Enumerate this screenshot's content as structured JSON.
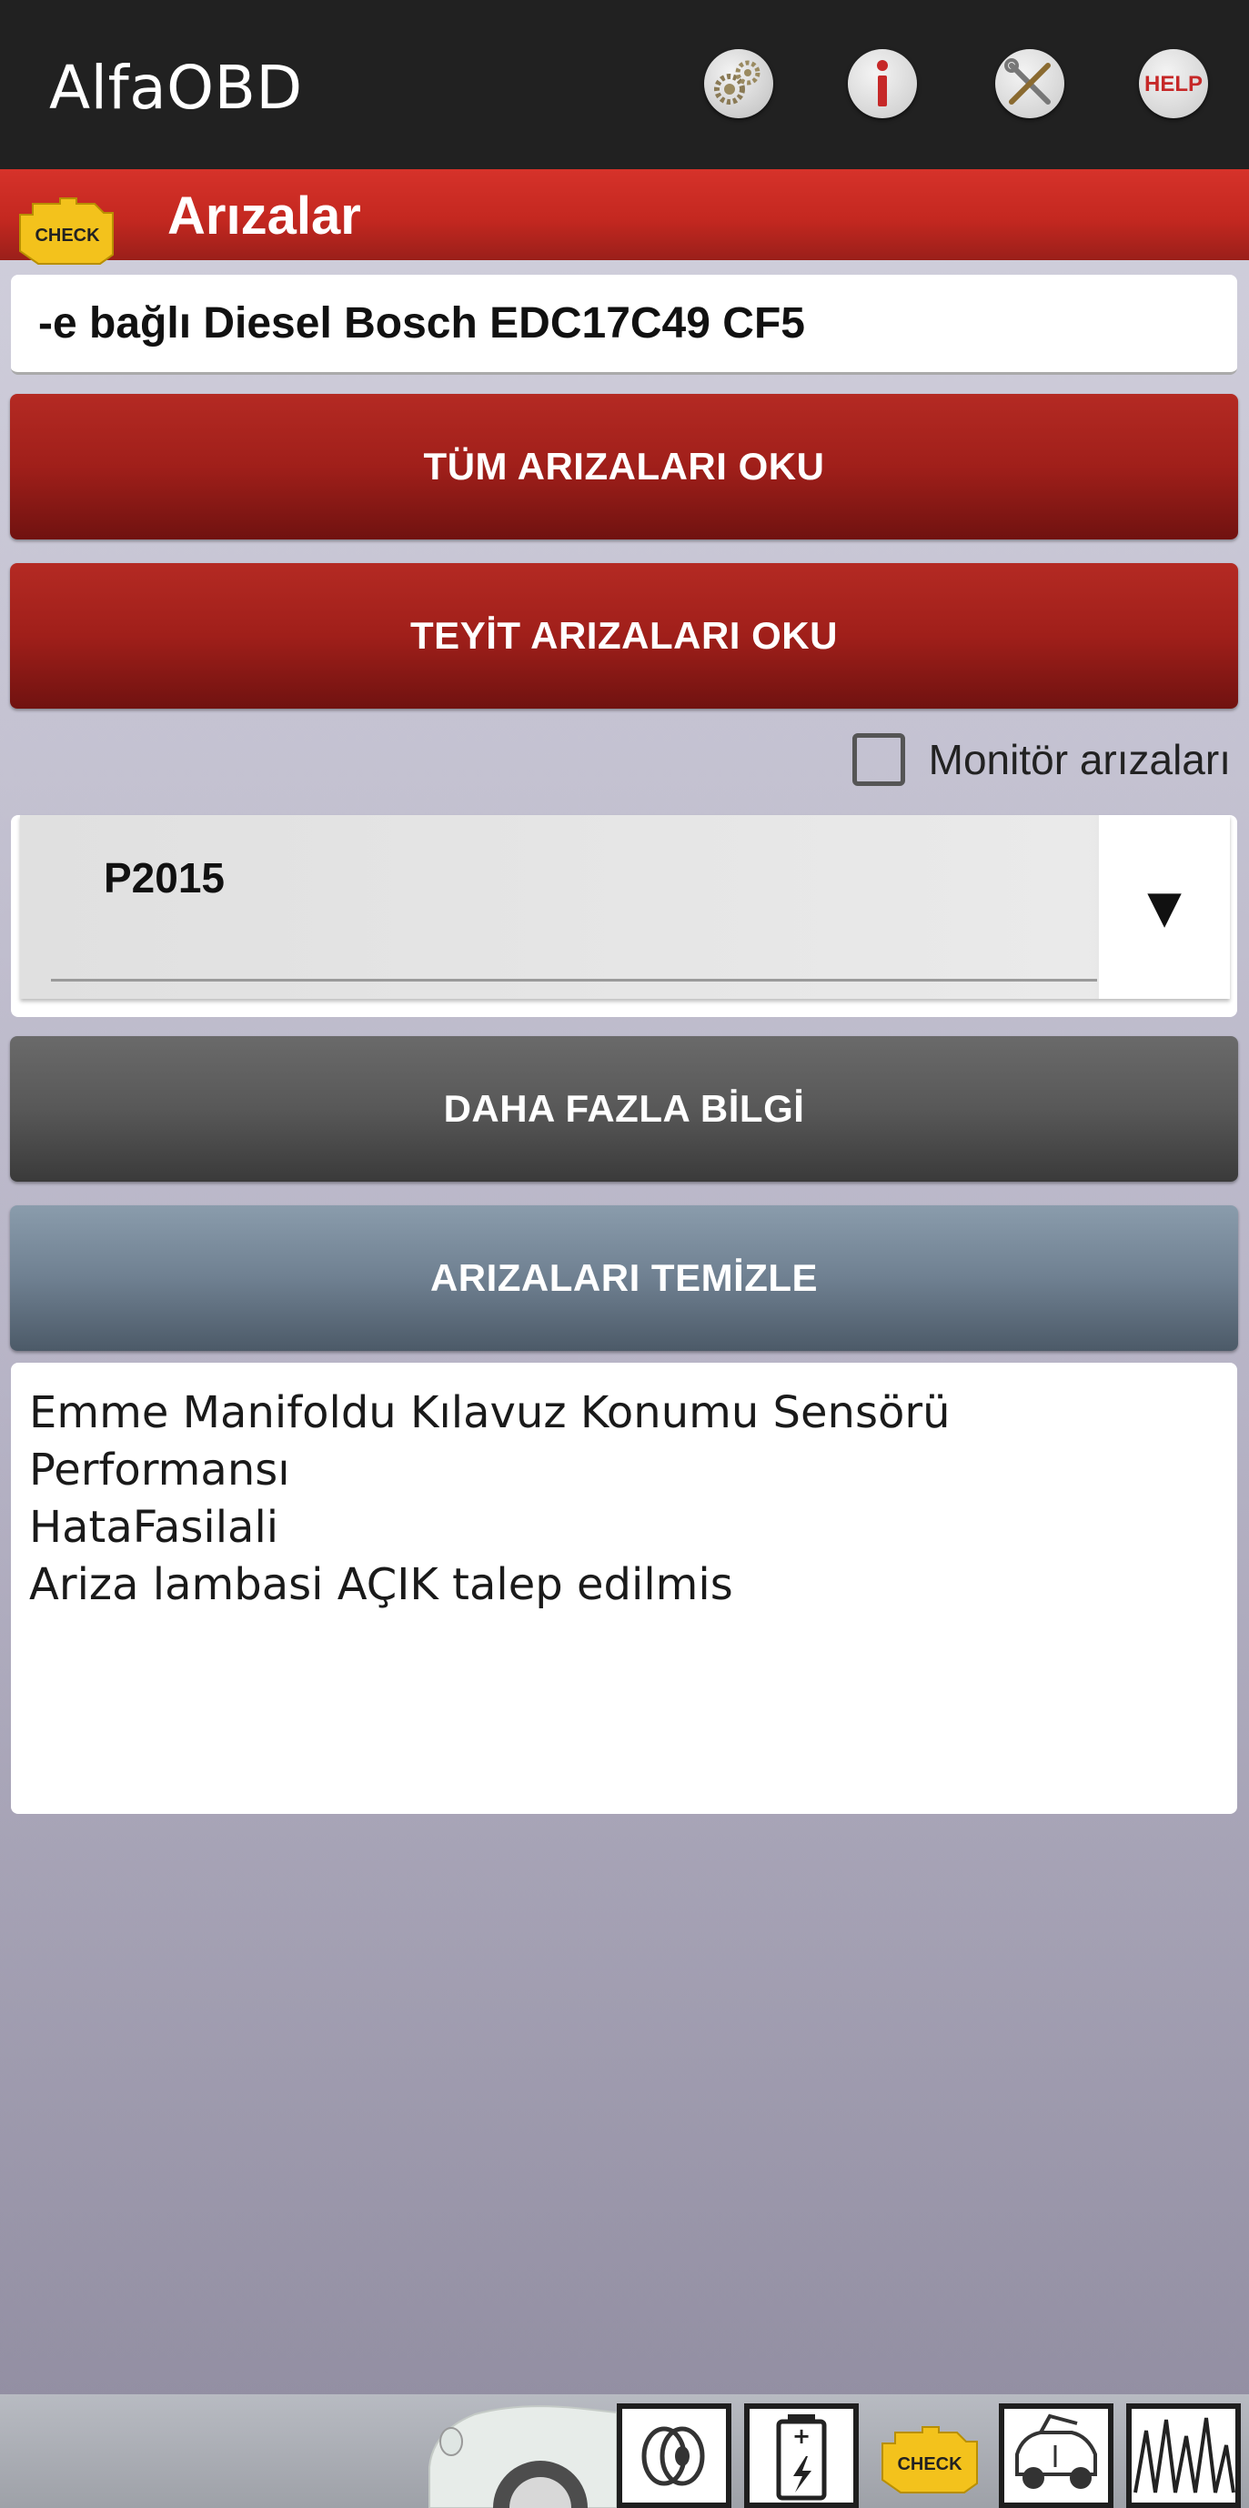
{
  "appbar": {
    "title": "AlfaOBD",
    "buttons": [
      {
        "name": "settings-gear-icon"
      },
      {
        "name": "info-icon"
      },
      {
        "name": "tools-icon"
      },
      {
        "name": "help-icon",
        "label": "HELP"
      }
    ]
  },
  "header": {
    "badge": "CHECK",
    "title": "Arızalar"
  },
  "ecu": {
    "value": "-e bağlı Diesel Bosch EDC17C49 CF5"
  },
  "buttons": {
    "read_all": "TÜM ARIZALARI OKU",
    "read_confirmed": "TEYİT ARIZALARI OKU",
    "more_info": "DAHA FAZLA BİLGİ",
    "clear": "ARIZALARI TEMİZLE"
  },
  "monitor": {
    "label": "Monitör arızaları",
    "checked": false
  },
  "dtc_select": {
    "selected": "P2015",
    "arrow": "▼"
  },
  "details": {
    "lines": [
      "Emme Manifoldu Kılavuz Konumu Sensörü",
      "Performansı",
      "HataFasilali",
      "Ariza lambasi AÇIK talep edilmis"
    ]
  },
  "bottom_nav": {
    "items": [
      {
        "name": "car-icon"
      },
      {
        "name": "speaker-icon"
      },
      {
        "name": "battery-icon"
      },
      {
        "name": "check-engine-icon",
        "label": "CHECK"
      },
      {
        "name": "car-service-icon"
      },
      {
        "name": "waveform-icon"
      }
    ]
  },
  "colors": {
    "appbar": "#212121",
    "header_red": "#c42820",
    "button_red": "#a01f1a",
    "button_dark": "#585858",
    "button_steel": "#6f8091",
    "check_yellow": "#f3c21c"
  }
}
